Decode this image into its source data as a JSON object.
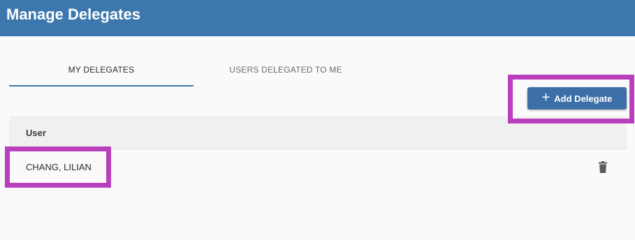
{
  "header": {
    "title": "Manage Delegates",
    "color": "#3c78ad"
  },
  "tabs": [
    {
      "label": "MY DELEGATES",
      "active": true
    },
    {
      "label": "USERS DELEGATED TO ME",
      "active": false
    }
  ],
  "toolbar": {
    "add_label": "Add Delegate",
    "add_icon": "plus-icon"
  },
  "table": {
    "columns": [
      "User"
    ],
    "rows": [
      {
        "user": "CHANG, LILIAN",
        "action_icon": "trash-icon"
      }
    ]
  },
  "highlight_color": "#b93fbd"
}
